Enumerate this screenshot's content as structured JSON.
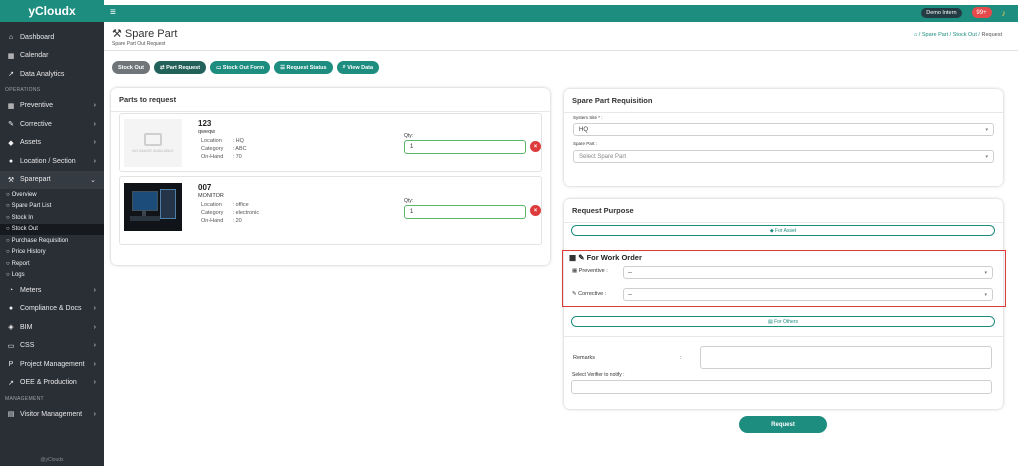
{
  "brand": "yCloudx",
  "sidebar": {
    "top_items": [
      {
        "label": "Dashboard",
        "icon": "home-icon"
      },
      {
        "label": "Calendar",
        "icon": "calendar-icon"
      },
      {
        "label": "Data Analytics",
        "icon": "chart-line-icon"
      }
    ],
    "operations_label": "OPERATIONS",
    "ops_items": [
      {
        "label": "Preventive",
        "icon": "calendar-icon"
      },
      {
        "label": "Corrective",
        "icon": "wrench-icon"
      },
      {
        "label": "Assets",
        "icon": "tag-icon"
      },
      {
        "label": "Location / Section",
        "icon": "location-pin-icon"
      },
      {
        "label": "Sparepart",
        "icon": "tools-icon"
      }
    ],
    "sparepart_sub": [
      {
        "label": "Overview"
      },
      {
        "label": "Spare Part List"
      },
      {
        "label": "Stock In"
      },
      {
        "label": "Stock Out"
      },
      {
        "label": "Purchase Requisition"
      },
      {
        "label": "Price History"
      },
      {
        "label": "Report"
      },
      {
        "label": "Logs"
      }
    ],
    "more_items": [
      {
        "label": "Meters",
        "icon": "gauge-icon"
      },
      {
        "label": "Compliance & Docs",
        "icon": "circle-icon"
      },
      {
        "label": "BIM",
        "icon": "cube-icon"
      },
      {
        "label": "CSS",
        "icon": "chat-icon"
      },
      {
        "label": "Project Management",
        "icon": "flag-icon"
      },
      {
        "label": "OEE & Production",
        "icon": "chart-line-icon"
      }
    ],
    "management_label": "MANAGEMENT",
    "mgmt_items": [
      {
        "label": "Visitor Management",
        "icon": "id-card-icon"
      }
    ],
    "footer": "@yCloudx"
  },
  "topbar": {
    "user": "Demo Intern",
    "notifications": "99+"
  },
  "page": {
    "title": "Spare Part",
    "subtitle": "Spare Part Out Request",
    "breadcrumb": [
      "Spare Part",
      "Stock Out",
      "Request"
    ]
  },
  "tabs": [
    {
      "label": "Stock Out"
    },
    {
      "label": "Part Request"
    },
    {
      "label": "Stock Out Form"
    },
    {
      "label": "Request Status"
    },
    {
      "label": "View Data"
    }
  ],
  "parts_card": {
    "title": "Parts to request",
    "no_image_text": "NO IMAGE AVAILABLE",
    "parts": [
      {
        "code": "123",
        "name": "qweqw",
        "location": "HQ",
        "category": "ABC",
        "on_hand": "70",
        "qty_label": "Qty:",
        "qty": "1"
      },
      {
        "code": "007",
        "name": "MONITOR",
        "location": "office",
        "category": "electronic",
        "on_hand": "20",
        "qty_label": "Qty:",
        "qty": "1"
      }
    ],
    "labels": {
      "location": "Location",
      "category": "Category",
      "on_hand": "On-Hand",
      "sep": ":"
    }
  },
  "requisition": {
    "title": "Spare Part Requisition",
    "system_site_label": "System Site * :",
    "system_site_value": "HQ",
    "spare_part_label": "Spare Part :",
    "spare_part_placeholder": "Select Spare Part"
  },
  "purpose": {
    "title": "Request Purpose",
    "for_asset": "For Asset",
    "for_work_order": "For Work Order",
    "preventive_label": "Preventive :",
    "preventive_value": "--",
    "corrective_label": "Corrective :",
    "corrective_value": "--",
    "for_others": "For Others",
    "remarks_label": "Remarks",
    "remarks_sep": ":",
    "verifier_label": "Select Verifier to notify :"
  },
  "submit_label": "Request",
  "colors": {
    "accent": "#1d8d80",
    "sidebar": "#2a2f36",
    "danger": "#dd3b3b"
  }
}
